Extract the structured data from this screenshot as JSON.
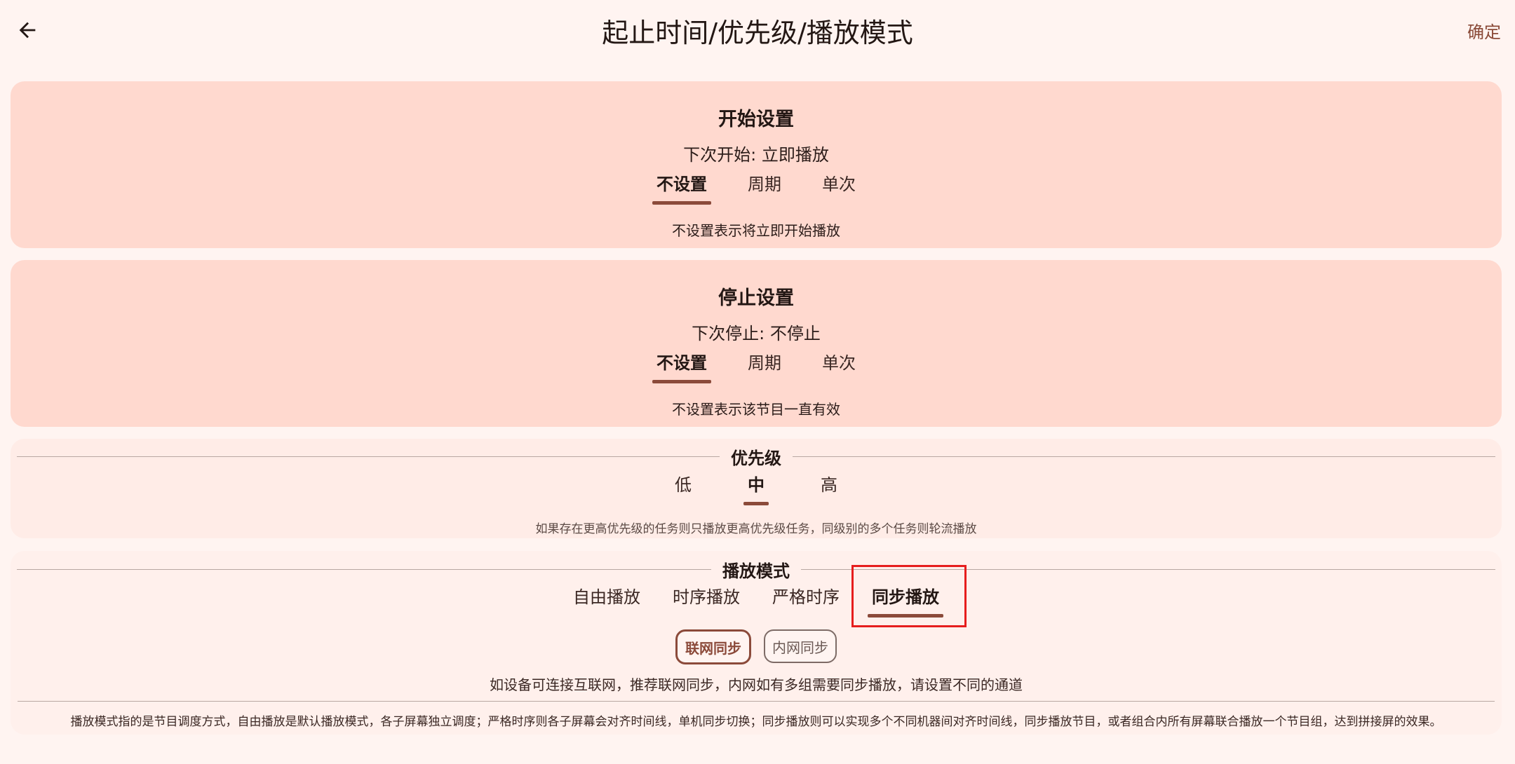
{
  "header": {
    "title": "起止时间/优先级/播放模式",
    "confirm_label": "确定"
  },
  "start_settings": {
    "title": "开始设置",
    "status": "下次开始: 立即播放",
    "tabs": [
      "不设置",
      "周期",
      "单次"
    ],
    "selected_tab": "不设置",
    "hint": "不设置表示将立即开始播放"
  },
  "stop_settings": {
    "title": "停止设置",
    "status": "下次停止: 不停止",
    "tabs": [
      "不设置",
      "周期",
      "单次"
    ],
    "selected_tab": "不设置",
    "hint": "不设置表示该节目一直有效"
  },
  "priority": {
    "title": "优先级",
    "options": [
      "低",
      "中",
      "高"
    ],
    "selected": "中",
    "hint": "如果存在更高优先级的任务则只播放更高优先级任务，同级别的多个任务则轮流播放"
  },
  "play_mode": {
    "title": "播放模式",
    "options": [
      "自由播放",
      "时序播放",
      "严格时序",
      "同步播放"
    ],
    "selected": "同步播放",
    "sync_chips": [
      "联网同步",
      "内网同步"
    ],
    "selected_chip": "联网同步",
    "sync_hint": "如设备可连接互联网，推荐联网同步，内网如有多组需要同步播放，请设置不同的通道",
    "footer_note": "播放模式指的是节目调度方式，自由播放是默认播放模式，各子屏幕独立调度；严格时序则各子屏幕会对齐时间线，单机同步切换；同步播放则可以实现多个不同机器间对齐时间线，同步播放节目，或者组合内所有屏幕联合播放一个节目组，达到拼接屏的效果。"
  },
  "colors": {
    "accent": "#8b4a3a",
    "card_strong": "#ffd9cf",
    "highlight": "#e61e1e"
  },
  "icons": {
    "back": "arrow-left-icon"
  }
}
